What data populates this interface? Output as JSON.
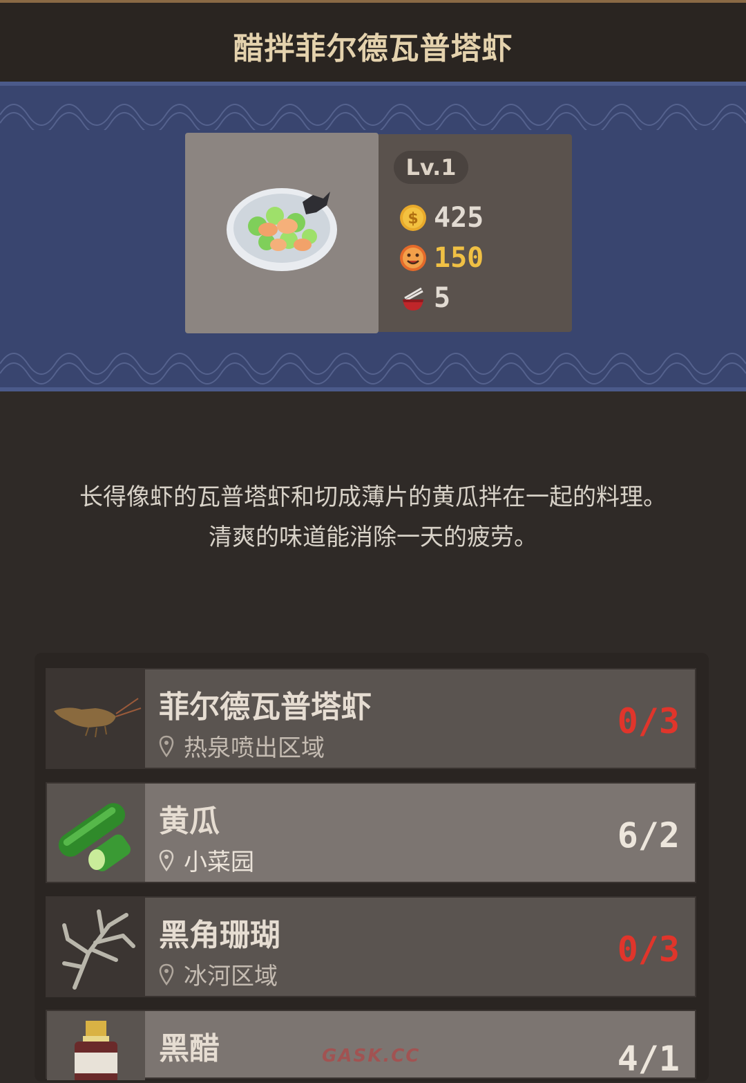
{
  "header": {
    "title": "醋拌菲尔德瓦普塔虾"
  },
  "dish": {
    "level": "Lv.1",
    "price": "425",
    "satisfaction": "150",
    "servings": "5",
    "icons": {
      "price": "coin-icon",
      "satisfaction": "tasty-face-icon",
      "servings": "bowl-chopsticks-icon"
    },
    "colors": {
      "gold": "#f0c044",
      "white": "#e2dbd2"
    }
  },
  "description": {
    "line1": "长得像虾的瓦普塔虾和切成薄片的黄瓜拌在一起的料理。",
    "line2": "清爽的味道能消除一天的疲劳。"
  },
  "ingredients": [
    {
      "name": "菲尔德瓦普塔虾",
      "location": "热泉喷出区域",
      "count": "0/3",
      "status": "insufficient",
      "icon": "shrimp-icon"
    },
    {
      "name": "黄瓜",
      "location": "小菜园",
      "count": "6/2",
      "status": "sufficient",
      "icon": "cucumber-icon"
    },
    {
      "name": "黑角珊瑚",
      "location": "冰河区域",
      "count": "0/3",
      "status": "insufficient",
      "icon": "coral-icon"
    },
    {
      "name": "黑醋",
      "location": "",
      "count": "4/1",
      "status": "sufficient",
      "icon": "vinegar-bottle-icon"
    }
  ],
  "colors": {
    "insufficient": "#e0352b",
    "sufficient": "#ede6dc",
    "banner": "#39456f"
  },
  "watermark": "GASK.CC"
}
